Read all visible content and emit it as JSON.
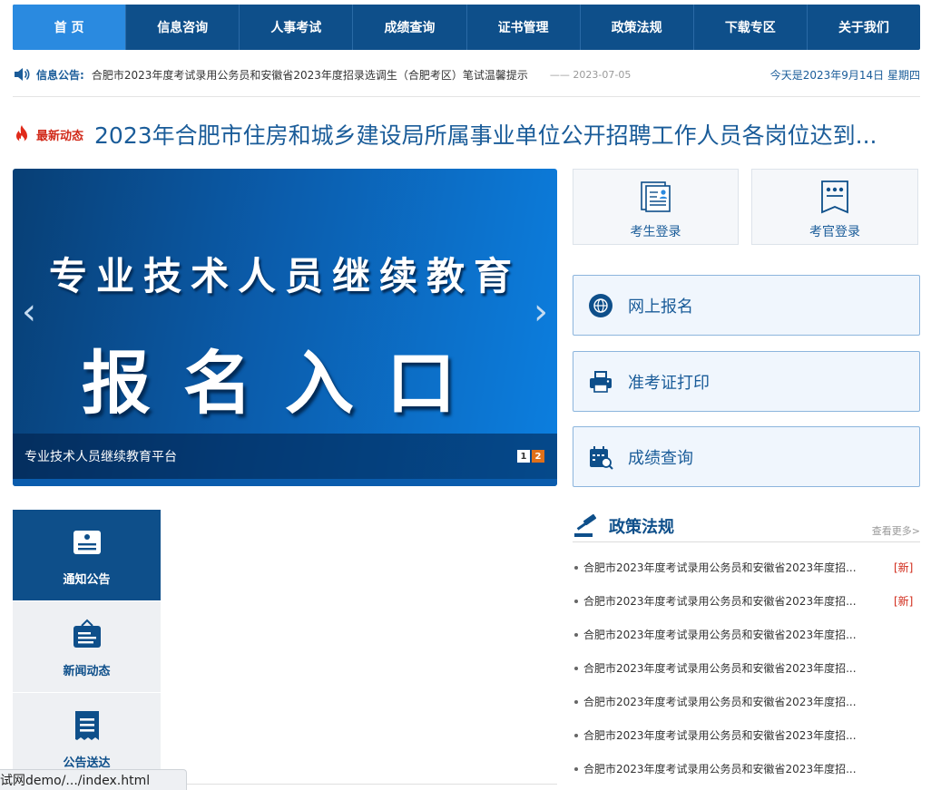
{
  "nav": {
    "items": [
      {
        "label": "首  页"
      },
      {
        "label": "信息咨询"
      },
      {
        "label": "人事考试"
      },
      {
        "label": "成绩查询"
      },
      {
        "label": "证书管理"
      },
      {
        "label": "政策法规"
      },
      {
        "label": "下载专区"
      },
      {
        "label": "关于我们"
      }
    ],
    "active_index": 0
  },
  "notice": {
    "label": "信息公告:",
    "text": "合肥市2023年度考试录用公务员和安徽省2023年度招录选调生（合肥考区）笔试温馨提示",
    "date": "—— 2023-07-05",
    "today": "今天是2023年9月14日 星期四"
  },
  "headline": {
    "label": "最新动态",
    "text": "2023年合肥市住房和城乡建设局所属事业单位公开招聘工作人员各岗位达到..."
  },
  "banner": {
    "line1": "专业技术人员继续教育",
    "line2": "报名入口",
    "caption": "专业技术人员继续教育平台",
    "pages": [
      "1",
      "2"
    ],
    "arrow_left": "‹",
    "arrow_right": "›"
  },
  "login": {
    "candidate": "考生登录",
    "examiner": "考官登录"
  },
  "actions": {
    "register": "网上报名",
    "admission": "准考证打印",
    "score": "成绩查询"
  },
  "side_tabs": [
    {
      "label": "通知公告"
    },
    {
      "label": "新闻动态"
    },
    {
      "label": "公告送达"
    }
  ],
  "policy": {
    "title": "政策法规",
    "more": "查看更多>",
    "items": [
      {
        "text": "合肥市2023年度考试录用公务员和安徽省2023年度招...",
        "badge": "[新]"
      },
      {
        "text": "合肥市2023年度考试录用公务员和安徽省2023年度招...",
        "badge": "[新]"
      },
      {
        "text": "合肥市2023年度考试录用公务员和安徽省2023年度招...",
        "badge": ""
      },
      {
        "text": "合肥市2023年度考试录用公务员和安徽省2023年度招...",
        "badge": ""
      },
      {
        "text": "合肥市2023年度考试录用公务员和安徽省2023年度招...",
        "badge": ""
      },
      {
        "text": "合肥市2023年度考试录用公务员和安徽省2023年度招...",
        "badge": ""
      },
      {
        "text": "合肥市2023年度考试录用公务员和安徽省2023年度招...",
        "badge": ""
      }
    ]
  },
  "status_bar": {
    "url": "试网demo/.../index.html"
  },
  "colors": {
    "primary": "#0e4f8a",
    "nav_active": "#2a8ae0",
    "accent_red": "#d12a1a",
    "text_blue": "#1a5c99"
  },
  "icons": {
    "notice": "speaker-icon",
    "headline": "flame-icon",
    "candidate": "id-card-icon",
    "examiner": "ribbon-badge-icon",
    "register": "globe-icon",
    "admission": "printer-icon",
    "score": "calendar-search-icon",
    "tab1": "notice-board-icon",
    "tab2": "hanging-sign-icon",
    "tab3": "receipt-icon",
    "policy": "gavel-icon"
  }
}
